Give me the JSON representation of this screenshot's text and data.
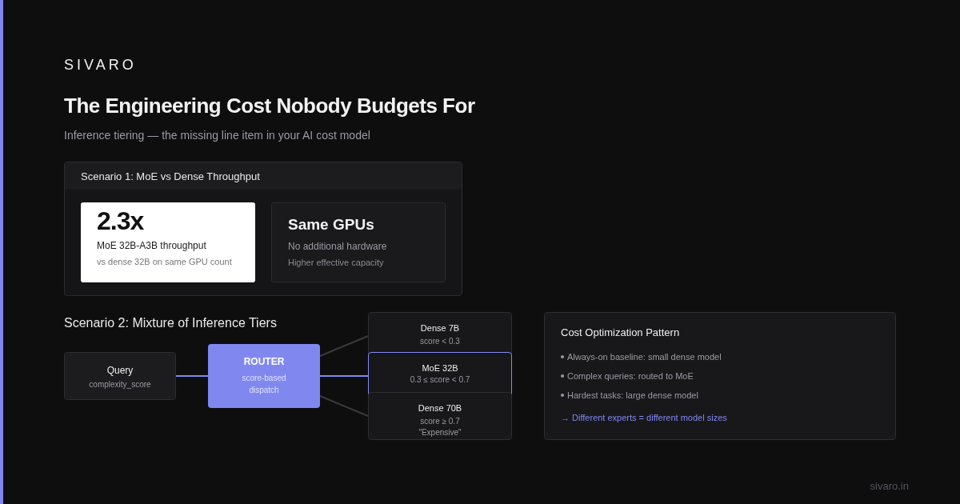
{
  "brand": "SIVARO",
  "title": "The Engineering Cost Nobody Budgets For",
  "subtitle": "Inference tiering — the missing line item in your AI cost model",
  "scenario1": {
    "heading": "Scenario 1: MoE vs Dense Throughput",
    "cards": [
      {
        "kind": "highlight",
        "value": "2.3x",
        "label": "MoE 32B-A3B throughput",
        "note": "vs dense 32B on same GPU count"
      },
      {
        "kind": "plain",
        "value": "Same GPUs",
        "label": "No additional hardware",
        "note": "Higher effective capacity"
      }
    ]
  },
  "scenario2": {
    "heading": "Scenario 2: Mixture of Inference Tiers",
    "query": {
      "title": "Query",
      "subtitle": "complexity_score"
    },
    "router": {
      "title": "ROUTER",
      "lines": [
        "score-based",
        "dispatch"
      ]
    },
    "tiers": [
      {
        "title": "Dense 7B",
        "lines": [
          "score < 0.3"
        ],
        "selected": false
      },
      {
        "title": "MoE 32B",
        "lines": [
          "0.3 ≤ score < 0.7"
        ],
        "selected": true
      },
      {
        "title": "Dense 70B",
        "lines": [
          "score ≥ 0.7",
          "\"Expensive\""
        ],
        "selected": false
      }
    ]
  },
  "pattern": {
    "title": "Cost Optimization Pattern",
    "bullets": [
      "Always-on baseline: small dense model",
      "Complex queries: routed to MoE",
      "Hardest tasks: large dense model"
    ],
    "conclusion": "→ Different experts = different model sizes"
  },
  "footer": "sivaro.in"
}
